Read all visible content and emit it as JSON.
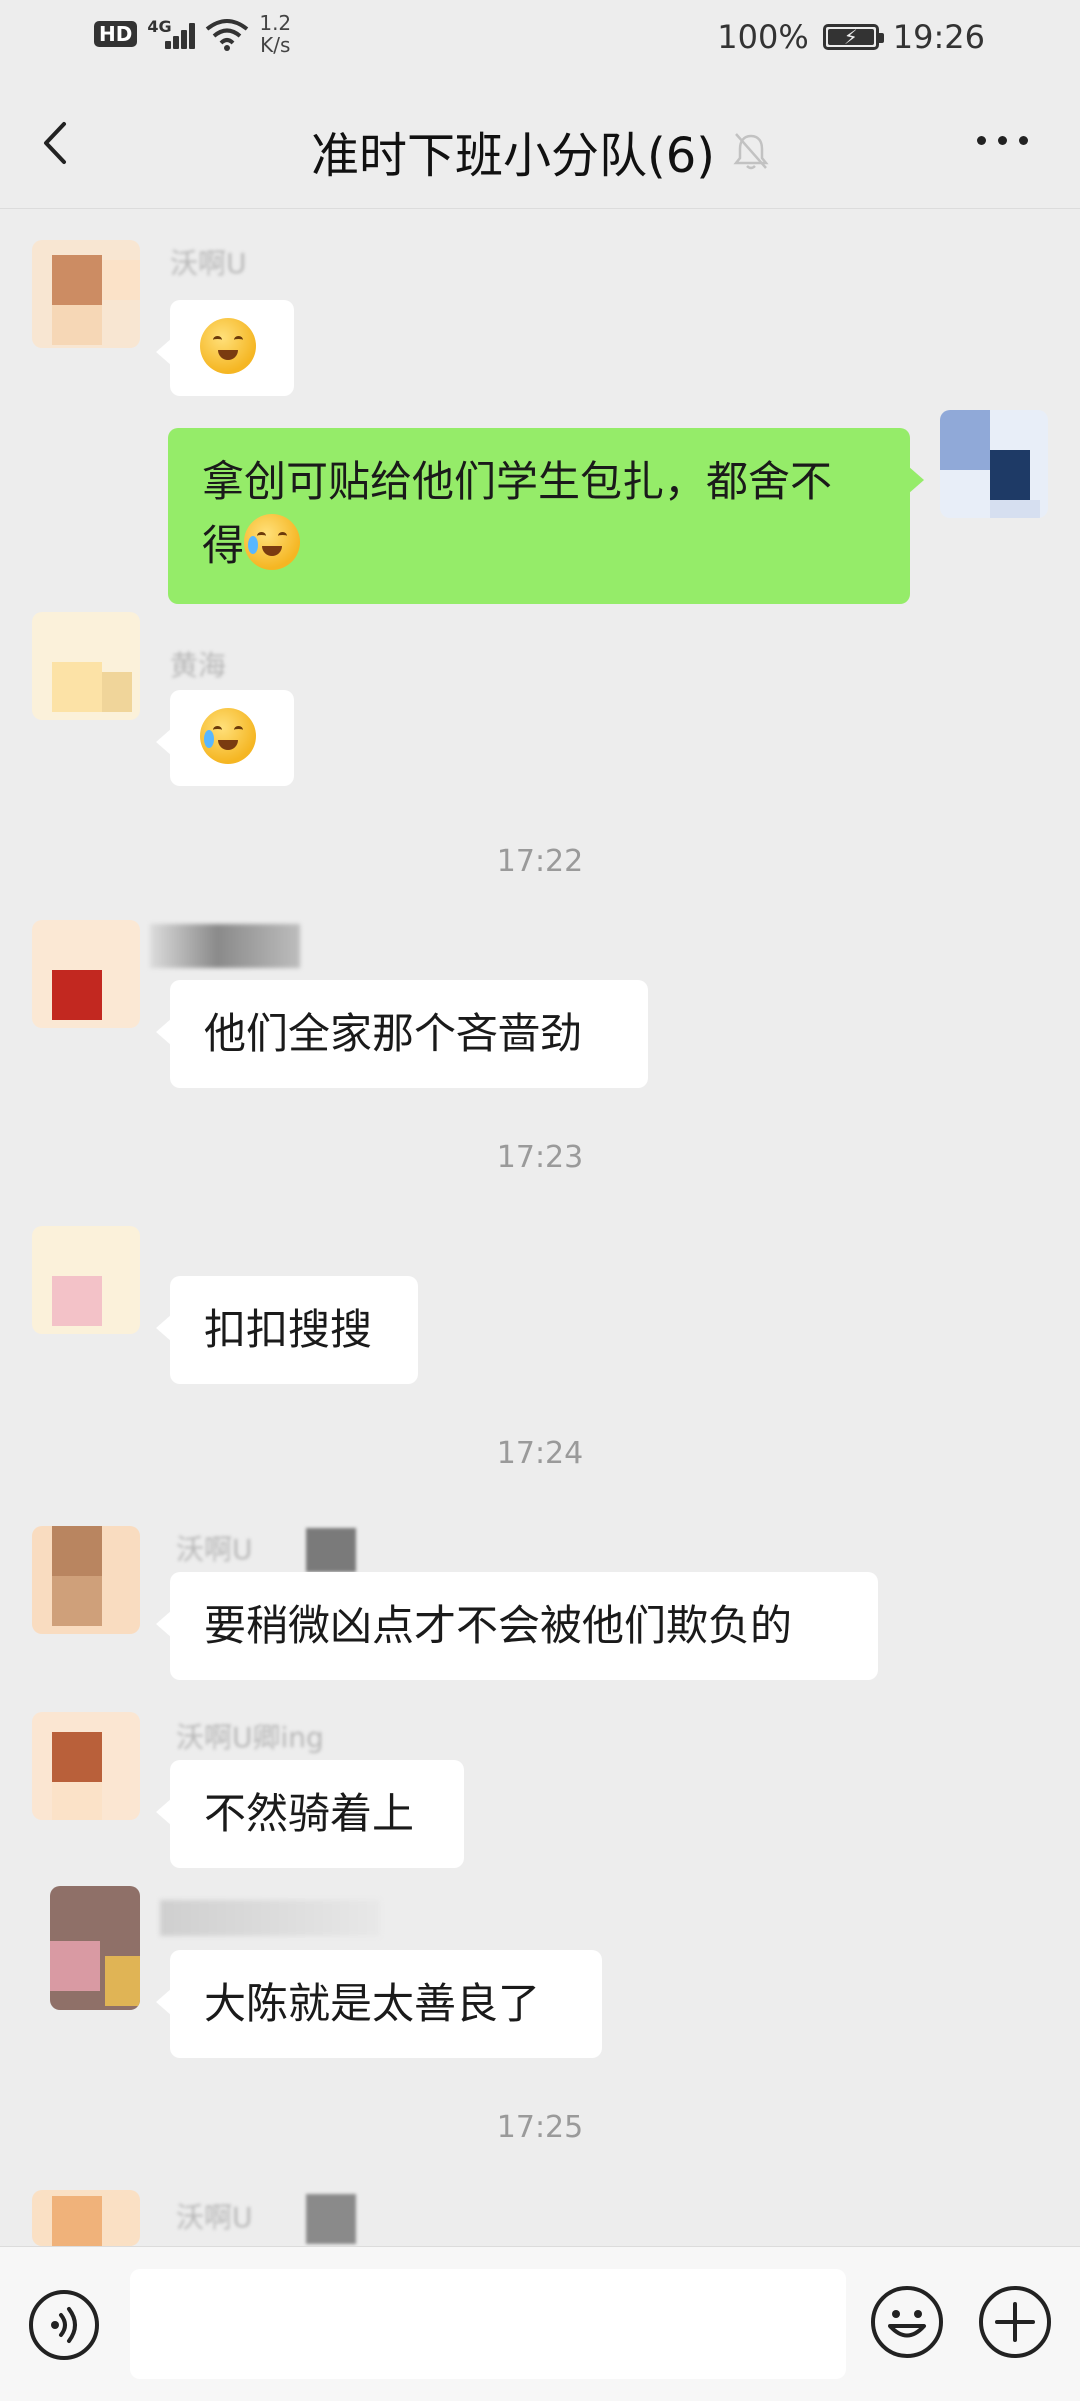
{
  "status_bar": {
    "hd": "HD",
    "network": "4G",
    "speed_top": "1.2",
    "speed_bottom": "K/s",
    "battery": "100%",
    "time": "19:26"
  },
  "header": {
    "title": "准时下班小分队(6)",
    "back_icon": "chevron-left-icon",
    "mute_icon": "bell-off-icon",
    "more_icon": "more-dots-icon"
  },
  "messages": [
    {
      "side": "left",
      "nickname": "沃啊U",
      "text": ""
    },
    {
      "side": "right",
      "text_line1": "拿创可贴给他们学生包扎，都舍不",
      "text_line2": "得"
    },
    {
      "side": "left",
      "nickname": "黄海",
      "text": ""
    },
    {
      "side": "left",
      "nickname": "",
      "text": "他们全家那个吝啬劲"
    },
    {
      "side": "left",
      "nickname": "",
      "text": "扣扣搜搜"
    },
    {
      "side": "left",
      "nickname": "沃啊U",
      "text": "要稍微凶点才不会被他们欺负的"
    },
    {
      "side": "left",
      "nickname": "沃啊U卿ing",
      "text": "不然骑着上"
    },
    {
      "side": "left",
      "nickname": "",
      "text": "大陈就是太善良了"
    },
    {
      "side": "left",
      "nickname": "沃啊U",
      "text": ""
    }
  ],
  "timestamps": [
    "17:22",
    "17:23",
    "17:24",
    "17:25"
  ],
  "input_bar": {
    "voice_icon": "voice-icon",
    "emoji_icon": "emoji-icon",
    "plus_icon": "plus-icon",
    "input_value": ""
  }
}
